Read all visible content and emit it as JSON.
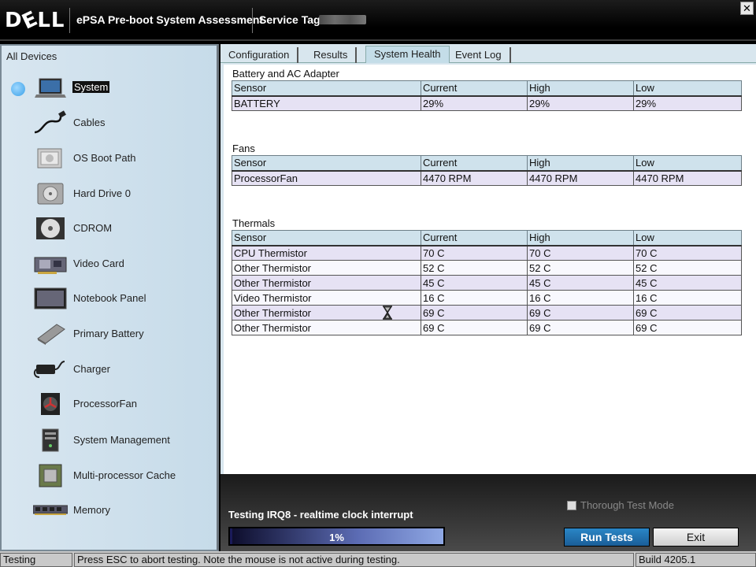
{
  "window": {
    "brand": "DELL",
    "title": "ePSA Pre-boot System Assessment",
    "service_tag_label": "Service Tag",
    "close_glyph": "✕"
  },
  "sidebar": {
    "header": "All Devices",
    "items": [
      {
        "label": "System",
        "icon": "laptop-icon",
        "selected": true
      },
      {
        "label": "Cables",
        "icon": "cable-icon"
      },
      {
        "label": "OS Boot Path",
        "icon": "boot-path-icon"
      },
      {
        "label": "Hard Drive 0",
        "icon": "hard-drive-icon"
      },
      {
        "label": "CDROM",
        "icon": "cdrom-icon"
      },
      {
        "label": "Video Card",
        "icon": "video-card-icon"
      },
      {
        "label": "Notebook Panel",
        "icon": "notebook-panel-icon"
      },
      {
        "label": "Primary Battery",
        "icon": "battery-icon"
      },
      {
        "label": "Charger",
        "icon": "charger-icon"
      },
      {
        "label": "ProcessorFan",
        "icon": "fan-icon"
      },
      {
        "label": "System Management",
        "icon": "system-management-icon"
      },
      {
        "label": "Multi-processor Cache",
        "icon": "cpu-chip-icon"
      },
      {
        "label": "Memory",
        "icon": "memory-icon"
      }
    ]
  },
  "tabs": [
    {
      "label": "Configuration"
    },
    {
      "label": "Results"
    },
    {
      "label": "System Health",
      "active": true
    },
    {
      "label": "Event Log"
    }
  ],
  "columns": {
    "sensor": "Sensor",
    "current": "Current",
    "high": "High",
    "low": "Low"
  },
  "sections": {
    "battery": {
      "title": "Battery and AC Adapter",
      "rows": [
        [
          "BATTERY",
          "29%",
          "29%",
          "29%"
        ]
      ]
    },
    "fans": {
      "title": "Fans",
      "rows": [
        [
          "ProcessorFan",
          "4470 RPM",
          "4470 RPM",
          "4470 RPM"
        ]
      ]
    },
    "thermals": {
      "title": "Thermals",
      "rows": [
        [
          "CPU Thermistor",
          "70 C",
          "70 C",
          "70 C"
        ],
        [
          "Other Thermistor",
          "52 C",
          "52 C",
          "52 C"
        ],
        [
          "Other Thermistor",
          "45 C",
          "45 C",
          "45 C"
        ],
        [
          "Video Thermistor",
          "16 C",
          "16 C",
          "16 C"
        ],
        [
          "Other Thermistor",
          "69 C",
          "69 C",
          "69 C"
        ],
        [
          "Other Thermistor",
          "69 C",
          "69 C",
          "69 C"
        ]
      ]
    }
  },
  "bottom": {
    "thorough_label": "Thorough Test Mode",
    "testing_status": "Testing IRQ8 - realtime clock interrupt",
    "progress_percent": 1,
    "progress_label": "1%",
    "run_label": "Run Tests",
    "exit_label": "Exit"
  },
  "statusbar": {
    "state": "Testing",
    "message": "Press ESC to abort testing.  Note the mouse is not active during testing.",
    "build": "Build  4205.1"
  }
}
